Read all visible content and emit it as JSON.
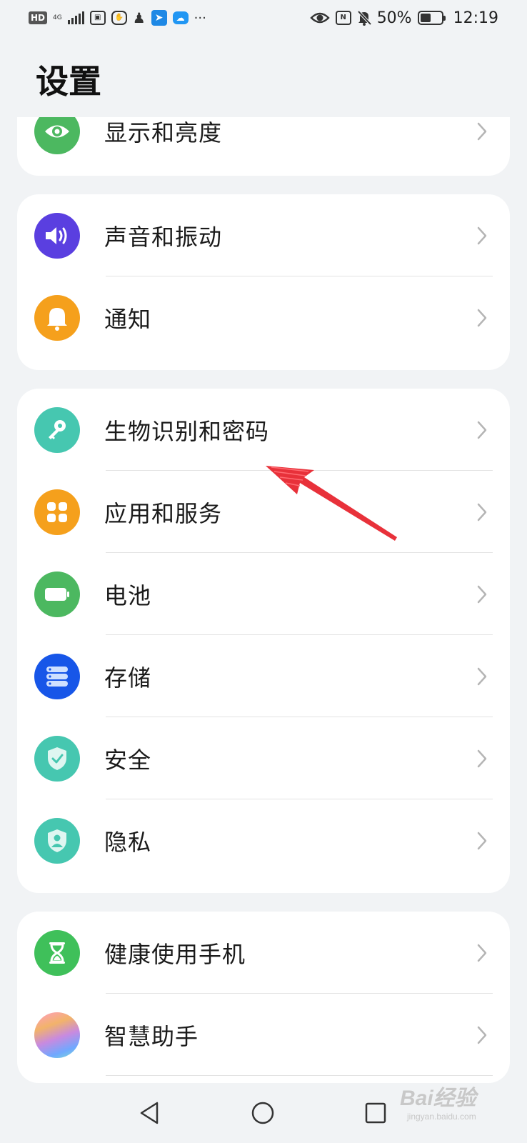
{
  "status_bar": {
    "hd": "HD",
    "network": "4G",
    "battery_text": "50%",
    "battery_level": 0.5,
    "time": "12:19",
    "more": "···"
  },
  "page": {
    "title": "设置"
  },
  "groups": [
    {
      "items": [
        {
          "label": "显示和亮度",
          "icon": "eye-icon",
          "color": "#4cb860"
        }
      ]
    },
    {
      "items": [
        {
          "label": "声音和振动",
          "icon": "speaker-icon",
          "color": "#5a3fe0"
        },
        {
          "label": "通知",
          "icon": "bell-icon",
          "color": "#f5a01c"
        }
      ]
    },
    {
      "items": [
        {
          "label": "生物识别和密码",
          "icon": "key-icon",
          "color": "#46c7b0"
        },
        {
          "label": "应用和服务",
          "icon": "apps-icon",
          "color": "#f5a01c"
        },
        {
          "label": "电池",
          "icon": "battery-icon",
          "color": "#4cb860"
        },
        {
          "label": "存储",
          "icon": "storage-icon",
          "color": "#1756e8"
        },
        {
          "label": "安全",
          "icon": "shield-check-icon",
          "color": "#46c7b0"
        },
        {
          "label": "隐私",
          "icon": "privacy-shield-icon",
          "color": "#46c7b0"
        }
      ]
    },
    {
      "items": [
        {
          "label": "健康使用手机",
          "icon": "hourglass-icon",
          "color": "#3fc05a"
        },
        {
          "label": "智慧助手",
          "icon": "assistant-orb-icon",
          "color": "#c88ae0"
        }
      ]
    }
  ],
  "annotation": {
    "color": "#e8313a",
    "points_to": "生物识别和密码"
  },
  "watermark": {
    "text": "Bai经验",
    "sub": "jingyan.baidu.com"
  }
}
